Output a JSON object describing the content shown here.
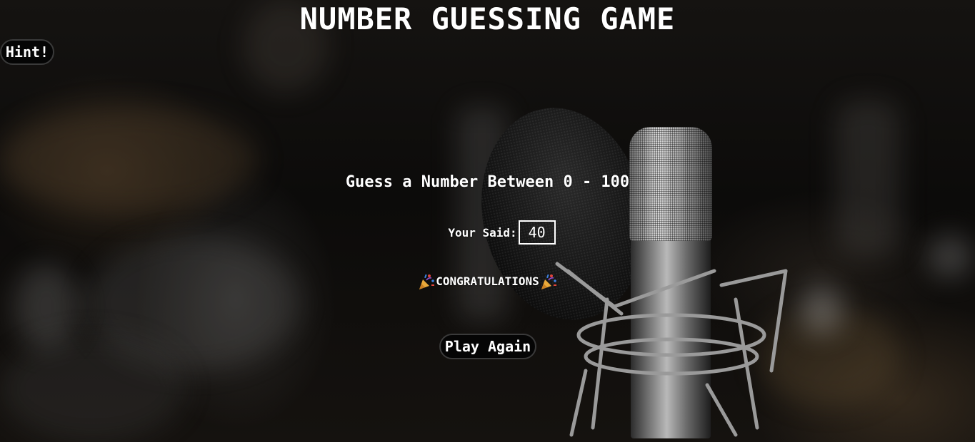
{
  "title": "NUMBER GUESSING GAME",
  "hint_button": {
    "label": "Hint!"
  },
  "prompt": "Guess a Number Between 0 - 100",
  "guess": {
    "label": "Your Said:",
    "value": "40"
  },
  "message": {
    "text": "CONGRATULATIONS",
    "icon": "party-popper-icon"
  },
  "play_again_button": {
    "label": "Play Again"
  },
  "colors": {
    "text": "#ffffff",
    "button_bg": "#050505",
    "button_border": "#3a3a3a",
    "popper_gold": "#e9a93a",
    "confetti_red": "#e2453c",
    "confetti_blue": "#3d7fe0"
  }
}
